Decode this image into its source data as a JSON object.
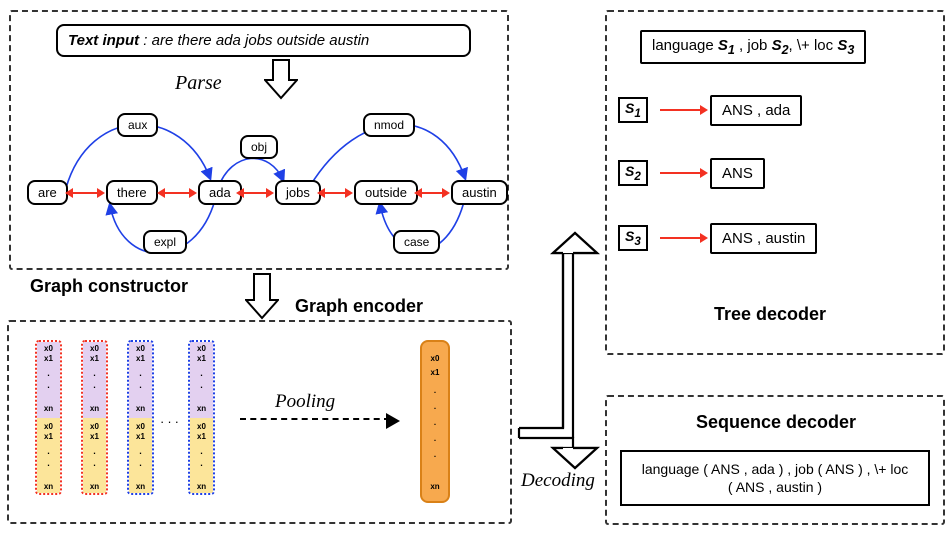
{
  "labels": {
    "graph_constructor": "Graph constructor",
    "graph_encoder": "Graph encoder",
    "tree_decoder": "Tree decoder",
    "sequence_decoder": "Sequence decoder",
    "parse": "Parse",
    "pooling": "Pooling",
    "decoding": "Decoding",
    "text_input_label": "Text input",
    "text_input_value": ": are there ada jobs outside austin"
  },
  "graph": {
    "tokens": [
      "are",
      "there",
      "ada",
      "jobs",
      "outside",
      "austin"
    ],
    "dep_labels": [
      "aux",
      "obj",
      "nmod",
      "expl",
      "case"
    ]
  },
  "tree_decoder": {
    "root": "language S1 , job S2, \\+ loc S3",
    "rules": [
      {
        "lhs": "S1",
        "rhs": "ANS , ada"
      },
      {
        "lhs": "S2",
        "rhs": "ANS"
      },
      {
        "lhs": "S3",
        "rhs": "ANS  , austin"
      }
    ]
  },
  "sequence_decoder": {
    "output_line1": "language ( ANS , ada ) , job ( ANS ) , \\+ loc",
    "output_line2": "( ANS , austin )"
  },
  "vec": {
    "x0": "x0",
    "x1": "x1",
    "xn": "xn",
    "dots": "."
  }
}
